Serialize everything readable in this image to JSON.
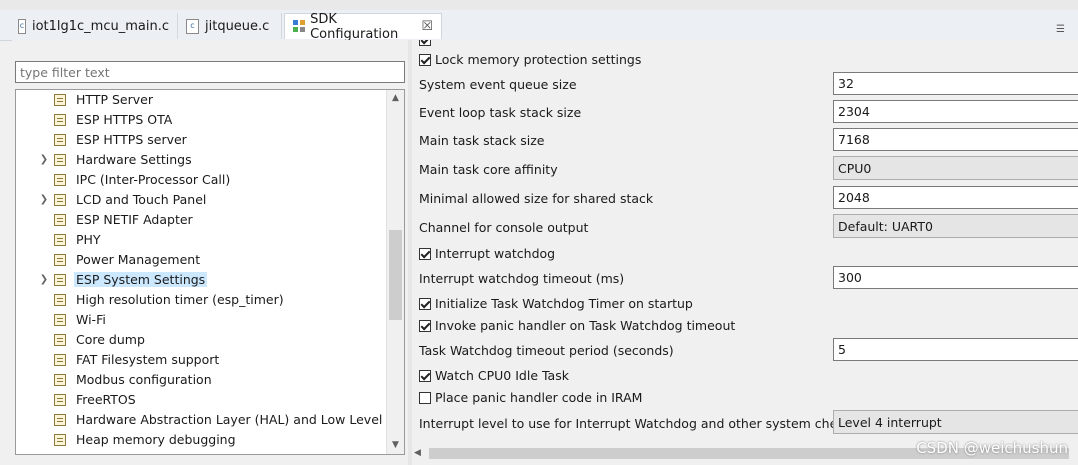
{
  "tabs": [
    {
      "label": "iot1lg1c_mcu_main.c",
      "icon": "c-file-icon"
    },
    {
      "label": "jitqueue.c",
      "icon": "c-file-icon"
    },
    {
      "label": "SDK Configuration",
      "icon": "sdk-config-icon",
      "close": "☒"
    }
  ],
  "filter": {
    "placeholder": "type filter text"
  },
  "tree": {
    "items": [
      {
        "label": "HTTP Server",
        "expandable": false
      },
      {
        "label": "ESP HTTPS OTA",
        "expandable": false
      },
      {
        "label": "ESP HTTPS server",
        "expandable": false
      },
      {
        "label": "Hardware Settings",
        "expandable": true
      },
      {
        "label": "IPC (Inter-Processor Call)",
        "expandable": false
      },
      {
        "label": "LCD and Touch Panel",
        "expandable": true
      },
      {
        "label": "ESP NETIF Adapter",
        "expandable": false
      },
      {
        "label": "PHY",
        "expandable": false
      },
      {
        "label": "Power Management",
        "expandable": false
      },
      {
        "label": "ESP System Settings",
        "expandable": true,
        "selected": true
      },
      {
        "label": "High resolution timer (esp_timer)",
        "expandable": false
      },
      {
        "label": "Wi-Fi",
        "expandable": false
      },
      {
        "label": "Core dump",
        "expandable": false
      },
      {
        "label": "FAT Filesystem support",
        "expandable": false
      },
      {
        "label": "Modbus configuration",
        "expandable": false
      },
      {
        "label": "FreeRTOS",
        "expandable": false
      },
      {
        "label": "Hardware Abstraction Layer (HAL) and Low Level (LL)",
        "expandable": false
      },
      {
        "label": "Heap memory debugging",
        "expandable": false
      }
    ]
  },
  "settings": {
    "lock_memory": {
      "label": "Lock memory protection settings",
      "checked": true
    },
    "event_queue": {
      "label": "System event queue size",
      "value": "32"
    },
    "event_loop_stack": {
      "label": "Event loop task stack size",
      "value": "2304"
    },
    "main_stack": {
      "label": "Main task stack size",
      "value": "7168"
    },
    "main_affinity": {
      "label": "Main task core affinity",
      "value": "CPU0"
    },
    "shared_stack": {
      "label": "Minimal allowed size for shared stack",
      "value": "2048"
    },
    "console_channel": {
      "label": "Channel for console output",
      "value": "Default: UART0"
    },
    "int_wdt": {
      "label": "Interrupt watchdog",
      "checked": true
    },
    "int_wdt_timeout": {
      "label": "Interrupt watchdog timeout (ms)",
      "value": "300"
    },
    "task_wdt_init": {
      "label": "Initialize Task Watchdog Timer on startup",
      "checked": true
    },
    "task_wdt_panic": {
      "label": "Invoke panic handler on Task Watchdog timeout",
      "checked": true
    },
    "task_wdt_timeout": {
      "label": "Task Watchdog timeout period (seconds)",
      "value": "5"
    },
    "watch_idle": {
      "label": "Watch CPU0 Idle Task",
      "checked": true
    },
    "panic_iram": {
      "label": "Place panic handler code in IRAM",
      "checked": false
    },
    "int_level": {
      "label": "Interrupt level to use for Interrupt Watchdog and other system checks",
      "value": "Level 4 interrupt"
    }
  },
  "watermark": "CSDN @weichushun"
}
